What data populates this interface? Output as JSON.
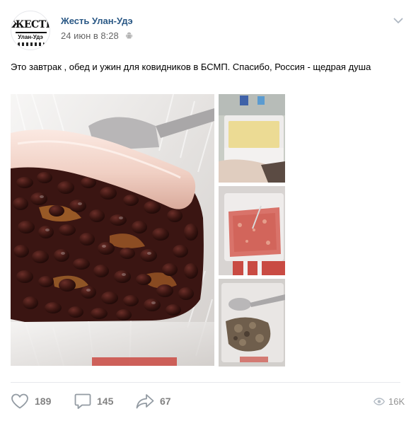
{
  "post": {
    "avatar": {
      "logo_top": "ЖЕСТЬ",
      "logo_bottom": "Улан-Удэ"
    },
    "group_name": "Жесть Улан-Удэ",
    "date": "24 июн в 8:28",
    "text": "Это завтрак , обед и ужин для ковидников в БСМП. Спасибо, Россия - щедрая душа",
    "photos": [
      "photo-beans-sausage",
      "photo-porridge",
      "photo-soup",
      "photo-meat-dish"
    ]
  },
  "footer": {
    "likes": "189",
    "comments": "145",
    "shares": "67",
    "views": "16K"
  },
  "icons": {
    "like": "heart-icon",
    "comment": "comment-icon",
    "share": "share-arrow-icon",
    "views": "eye-icon",
    "menu": "chevron-down-icon",
    "platform": "android-icon"
  },
  "colors": {
    "link": "#2a5885",
    "meta": "#656565",
    "action": "#828282",
    "divider": "#e7e8ec"
  }
}
